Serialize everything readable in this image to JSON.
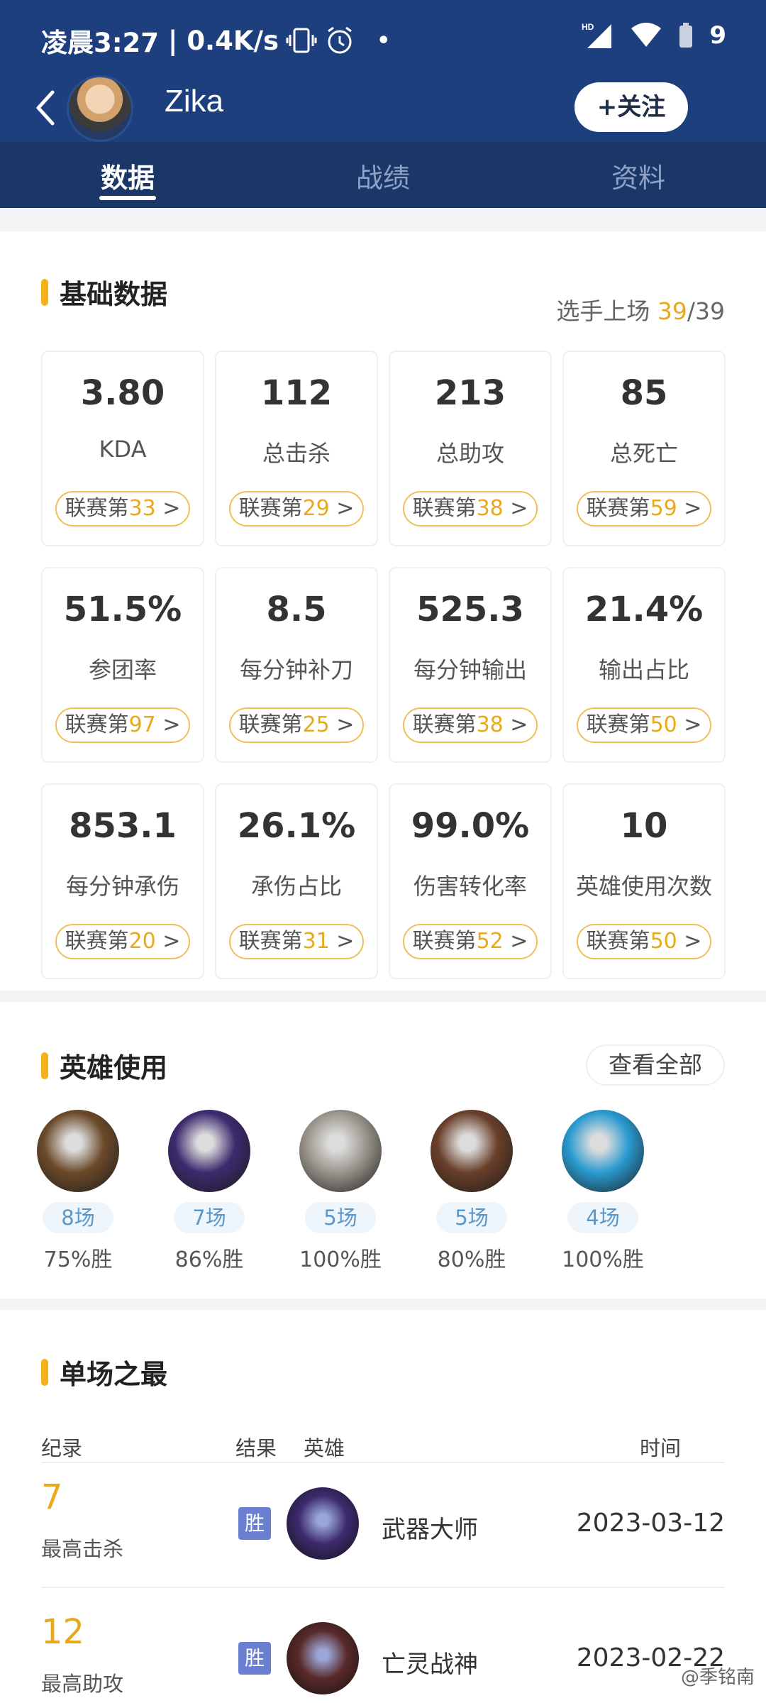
{
  "status_bar": {
    "time": "凌晨3:27",
    "speed": "0.4K/s",
    "battery": "9",
    "icons": [
      "vibrate-icon",
      "alarm-icon",
      "hd-signal-icon",
      "wifi-icon",
      "battery-icon"
    ]
  },
  "header": {
    "player_name": "Zika",
    "follow_label": "+关注"
  },
  "tabs": [
    {
      "label": "数据"
    },
    {
      "label": "战绩"
    },
    {
      "label": "资料"
    }
  ],
  "basic": {
    "title": "基础数据",
    "played_label": "选手上场",
    "played": "39",
    "total": "/39",
    "rank_prefix": "联赛第",
    "rank_suffix": ">",
    "stats": [
      {
        "value": "3.80",
        "label": "KDA",
        "rank": "33"
      },
      {
        "value": "112",
        "label": "总击杀",
        "rank": "29"
      },
      {
        "value": "213",
        "label": "总助攻",
        "rank": "38"
      },
      {
        "value": "85",
        "label": "总死亡",
        "rank": "59"
      },
      {
        "value": "51.5%",
        "label": "参团率",
        "rank": "97"
      },
      {
        "value": "8.5",
        "label": "每分钟补刀",
        "rank": "25"
      },
      {
        "value": "525.3",
        "label": "每分钟输出",
        "rank": "38"
      },
      {
        "value": "21.4%",
        "label": "输出占比",
        "rank": "50"
      },
      {
        "value": "853.1",
        "label": "每分钟承伤",
        "rank": "20"
      },
      {
        "value": "26.1%",
        "label": "承伤占比",
        "rank": "31"
      },
      {
        "value": "99.0%",
        "label": "伤害转化率",
        "rank": "52"
      },
      {
        "value": "10",
        "label": "英雄使用次数",
        "rank": "50"
      }
    ]
  },
  "heroes": {
    "title": "英雄使用",
    "view_all": "查看全部",
    "items": [
      {
        "games": "8场",
        "winrate": "75%胜",
        "color": "#6b4a2a"
      },
      {
        "games": "7场",
        "winrate": "86%胜",
        "color": "#3d2a6e"
      },
      {
        "games": "5场",
        "winrate": "100%胜",
        "color": "#9a948c"
      },
      {
        "games": "5场",
        "winrate": "80%胜",
        "color": "#6a3f2a"
      },
      {
        "games": "4场",
        "winrate": "100%胜",
        "color": "#2a9ad0"
      }
    ]
  },
  "best": {
    "title": "单场之最",
    "headers": {
      "record": "纪录",
      "result": "结果",
      "hero": "英雄",
      "time": "时间"
    },
    "rows": [
      {
        "value": "7",
        "label": "最高击杀",
        "result": "胜",
        "hero": "武器大师",
        "date": "2023-03-12",
        "color": "#3d2a6e"
      },
      {
        "value": "12",
        "label": "最高助攻",
        "result": "胜",
        "hero": "亡灵战神",
        "date": "2023-02-22",
        "color": "#5a2a2a"
      }
    ]
  },
  "watermark": "@季铭南"
}
